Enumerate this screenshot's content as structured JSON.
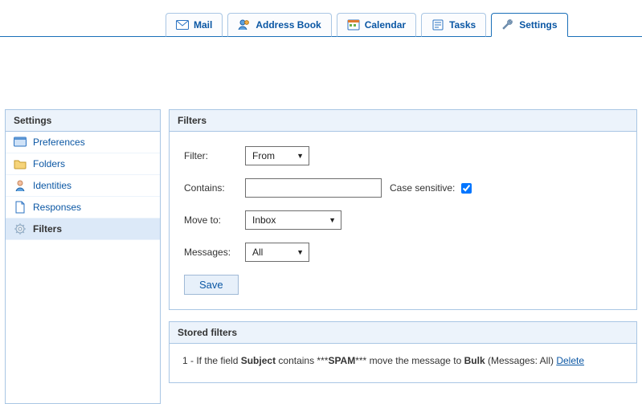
{
  "tabs": {
    "mail": "Mail",
    "address": "Address Book",
    "calendar": "Calendar",
    "tasks": "Tasks",
    "settings": "Settings",
    "active": "settings"
  },
  "sidebar": {
    "title": "Settings",
    "items": [
      {
        "label": "Preferences"
      },
      {
        "label": "Folders"
      },
      {
        "label": "Identities"
      },
      {
        "label": "Responses"
      },
      {
        "label": "Filters"
      }
    ],
    "selected": "Filters"
  },
  "filters_panel": {
    "title": "Filters",
    "filter_label": "Filter:",
    "filter_value": "From",
    "contains_label": "Contains:",
    "contains_value": "",
    "case_label": "Case sensitive:",
    "case_checked": true,
    "moveto_label": "Move to:",
    "moveto_value": "Inbox",
    "messages_label": "Messages:",
    "messages_value": "All",
    "save_label": "Save"
  },
  "stored_panel": {
    "title": "Stored filters",
    "rule_index": "1",
    "rule_prefix": " - If the field ",
    "rule_field": "Subject",
    "rule_mid1": " contains ***",
    "rule_match": "SPAM",
    "rule_mid2": "*** move the message to ",
    "rule_target": "Bulk",
    "rule_suffix": " (Messages: All) ",
    "delete_label": "Delete"
  }
}
